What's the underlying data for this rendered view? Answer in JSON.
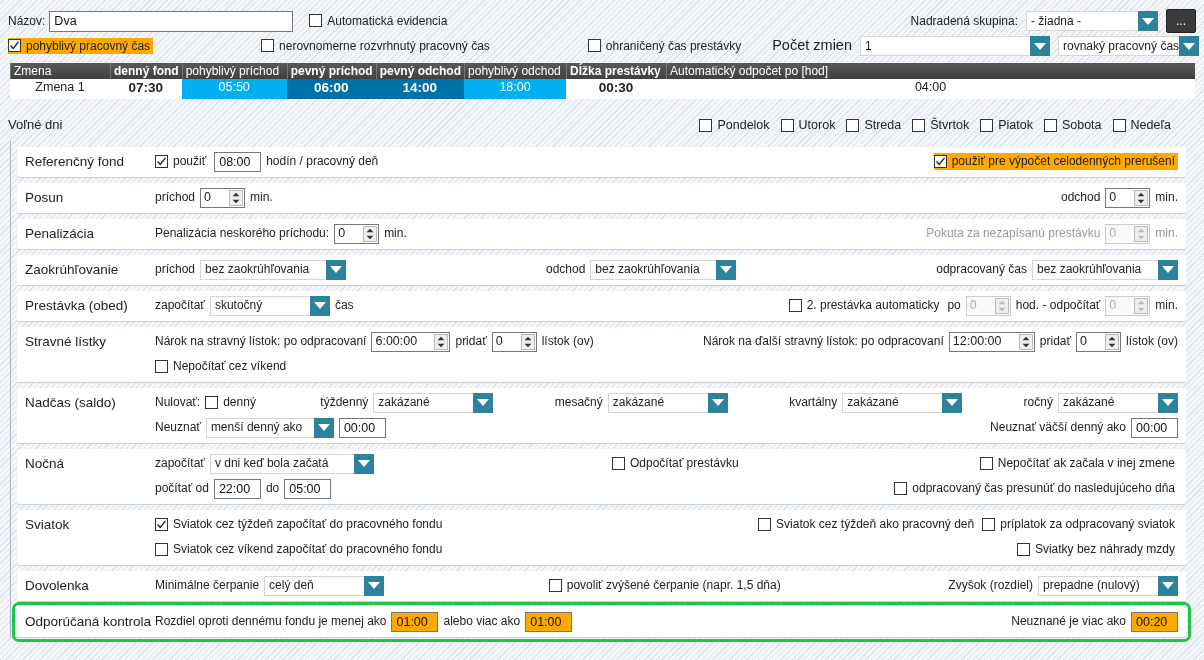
{
  "header": {
    "name_label": "Názov:",
    "name_value": "Dva",
    "auto_check": {
      "label": "Automatická evidencia",
      "checked": false
    },
    "parent_label": "Nadradená skupina:",
    "parent_value": "- žiadna -",
    "browse_button": "..."
  },
  "options": [
    {
      "label": "pohyblivý pracovný čas",
      "checked": true,
      "highlighted": true
    },
    {
      "label": "nerovnomerne rozvrhnutý pracovný čas",
      "checked": false,
      "highlighted": false
    },
    {
      "label": "ohraničený čas prestávky",
      "checked": false,
      "highlighted": false
    }
  ],
  "shift_count": {
    "label": "Počet zmien",
    "value": "1",
    "mode": "rovnaký pracovný čas"
  },
  "shift_table": {
    "columns": [
      {
        "label": "Zmena",
        "bold": false
      },
      {
        "label": "denný fond",
        "bold": true
      },
      {
        "label": "pohyblivý príchod",
        "bold": false
      },
      {
        "label": "pevný príchod",
        "bold": true
      },
      {
        "label": "pevný odchod",
        "bold": true
      },
      {
        "label": "pohyblivý odchod",
        "bold": false
      },
      {
        "label": "Dĺžka prestávky",
        "bold": true
      },
      {
        "label": "Automatický odpočet po [hod]",
        "bold": false
      }
    ],
    "rows": [
      {
        "cells": [
          {
            "text": "Zmena 1",
            "bold": false,
            "kind": "plain"
          },
          {
            "text": "07:30",
            "bold": true,
            "kind": "plain"
          },
          {
            "text": "05:50",
            "bold": false,
            "kind": "flexible"
          },
          {
            "text": "06:00",
            "bold": true,
            "kind": "fixed"
          },
          {
            "text": "14:00",
            "bold": true,
            "kind": "fixed"
          },
          {
            "text": "18:00",
            "bold": false,
            "kind": "flexible"
          },
          {
            "text": "00:30",
            "bold": true,
            "kind": "plain"
          },
          {
            "text": "04:00",
            "bold": false,
            "kind": "plain"
          }
        ]
      }
    ]
  },
  "free_days": {
    "label": "Voľné dni",
    "days": [
      {
        "label": "Pondelok",
        "checked": false
      },
      {
        "label": "Utorok",
        "checked": false
      },
      {
        "label": "Streda",
        "checked": false
      },
      {
        "label": "Štvrtok",
        "checked": false
      },
      {
        "label": "Piatok",
        "checked": false
      },
      {
        "label": "Sobota",
        "checked": false
      },
      {
        "label": "Nedeľa",
        "checked": false
      }
    ]
  },
  "sections": [
    {
      "label": "Referenčný fond",
      "emphasized": false,
      "lines": [
        [
          [
            {
              "kind": "check",
              "label": "použiť",
              "checked": true,
              "highlighted": false
            },
            {
              "kind": "field",
              "value": "08:00",
              "highlighted": false
            },
            {
              "kind": "text",
              "text": "hodín / pracovný deň",
              "disabled": false
            }
          ],
          [
            {
              "kind": "check",
              "label": "použiť pre výpočet celodenných prerušení",
              "checked": true,
              "highlighted": true
            }
          ]
        ]
      ]
    },
    {
      "label": "Posun",
      "emphasized": false,
      "lines": [
        [
          [
            {
              "kind": "text",
              "text": "príchod",
              "disabled": false
            },
            {
              "kind": "spin",
              "value": "0",
              "disabled": false
            },
            {
              "kind": "text",
              "text": "min.",
              "disabled": false
            }
          ],
          [
            {
              "kind": "text",
              "text": "odchod",
              "disabled": false
            },
            {
              "kind": "spin",
              "value": "0",
              "disabled": false
            },
            {
              "kind": "text",
              "text": "min.",
              "disabled": false
            }
          ]
        ]
      ]
    },
    {
      "label": "Penalizácia",
      "emphasized": false,
      "lines": [
        [
          [
            {
              "kind": "text",
              "text": "Penalizácia neskorého príchodu:",
              "disabled": false
            },
            {
              "kind": "spin",
              "value": "0",
              "disabled": false
            },
            {
              "kind": "text",
              "text": "min.",
              "disabled": false
            }
          ],
          [
            {
              "kind": "text",
              "text": "Pokuta za nezapísanú prestávku",
              "disabled": true
            },
            {
              "kind": "spin",
              "value": "0",
              "disabled": true
            },
            {
              "kind": "text",
              "text": "min.",
              "disabled": true
            }
          ]
        ]
      ]
    },
    {
      "label": "Zaokrúhľovanie",
      "emphasized": false,
      "lines": [
        [
          [
            {
              "kind": "text",
              "text": "príchod",
              "disabled": false
            },
            {
              "kind": "select",
              "value": "bez zaokrúhľovania"
            }
          ],
          [
            {
              "kind": "text",
              "text": "odchod",
              "disabled": false
            },
            {
              "kind": "select",
              "value": "bez zaokrúhľovania"
            }
          ],
          [
            {
              "kind": "text",
              "text": "odpracovaný čas",
              "disabled": false
            },
            {
              "kind": "select",
              "value": "bez zaokrúhľovania"
            }
          ]
        ]
      ]
    },
    {
      "label": "Prestávka (obed)",
      "emphasized": false,
      "lines": [
        [
          [
            {
              "kind": "text",
              "text": "započítať",
              "disabled": false
            },
            {
              "kind": "select",
              "value": "skutočný"
            },
            {
              "kind": "text",
              "text": "čas",
              "disabled": false
            }
          ],
          [
            {
              "kind": "check",
              "label": "2. prestávka automaticky",
              "checked": false,
              "highlighted": false
            },
            {
              "kind": "text",
              "text": "po",
              "disabled": false
            },
            {
              "kind": "spin",
              "value": "0",
              "disabled": true
            },
            {
              "kind": "text",
              "text": "hod. - odpočítať",
              "disabled": false
            },
            {
              "kind": "spin",
              "value": "0",
              "disabled": true
            },
            {
              "kind": "text",
              "text": "min.",
              "disabled": false
            }
          ]
        ]
      ]
    },
    {
      "label": "Stravné lístky",
      "emphasized": false,
      "lines": [
        [
          [
            {
              "kind": "text",
              "text": "Nárok na stravný lístok: po odpracovaní",
              "disabled": false
            },
            {
              "kind": "spin",
              "value": "6:00:00",
              "disabled": false
            },
            {
              "kind": "text",
              "text": "pridať",
              "disabled": false
            },
            {
              "kind": "spin",
              "value": "0",
              "disabled": false
            },
            {
              "kind": "text",
              "text": "lístok (ov)",
              "disabled": false
            }
          ],
          [
            {
              "kind": "text",
              "text": "Nárok na ďalší stravný lístok: po odpracovaní",
              "disabled": false
            },
            {
              "kind": "spin",
              "value": "12:00:00",
              "disabled": false
            },
            {
              "kind": "text",
              "text": "pridať",
              "disabled": false
            },
            {
              "kind": "spin",
              "value": "0",
              "disabled": false
            },
            {
              "kind": "text",
              "text": "lístok (ov)",
              "disabled": false
            }
          ]
        ],
        [
          [
            {
              "kind": "check",
              "label": "Nepočítať cez víkend",
              "checked": false,
              "highlighted": false
            }
          ]
        ]
      ]
    },
    {
      "label": "Nadčas (saldo)",
      "emphasized": false,
      "lines": [
        [
          [
            {
              "kind": "text",
              "text": "Nulovať:",
              "disabled": false
            },
            {
              "kind": "check",
              "label": "denný",
              "checked": false,
              "highlighted": false
            }
          ],
          [
            {
              "kind": "text",
              "text": "týždenný",
              "disabled": false
            },
            {
              "kind": "select",
              "value": "zakázané"
            }
          ],
          [
            {
              "kind": "text",
              "text": "mesačný",
              "disabled": false
            },
            {
              "kind": "select",
              "value": "zakázané"
            }
          ],
          [
            {
              "kind": "text",
              "text": "kvartálny",
              "disabled": false
            },
            {
              "kind": "select",
              "value": "zakázané"
            }
          ],
          [
            {
              "kind": "text",
              "text": "ročný",
              "disabled": false
            },
            {
              "kind": "select",
              "value": "zakázané"
            }
          ]
        ],
        [
          [
            {
              "kind": "text",
              "text": "Neuznať",
              "disabled": false
            },
            {
              "kind": "select",
              "value": "menší denný ako"
            },
            {
              "kind": "field",
              "value": "00:00",
              "highlighted": false
            }
          ],
          [
            {
              "kind": "text",
              "text": "Neuznať väčší denný ako",
              "disabled": false
            },
            {
              "kind": "field",
              "value": "00:00",
              "highlighted": false
            }
          ]
        ]
      ]
    },
    {
      "label": "Nočná",
      "emphasized": false,
      "lines": [
        [
          [
            {
              "kind": "text",
              "text": "započítať",
              "disabled": false
            },
            {
              "kind": "select",
              "value": "v dni keď bola začatá"
            }
          ],
          [
            {
              "kind": "check",
              "label": "Odpočítať prestávku",
              "checked": false,
              "highlighted": false
            }
          ],
          [
            {
              "kind": "check",
              "label": "Nepočítať ak začala v inej zmene",
              "checked": false,
              "highlighted": false
            }
          ]
        ],
        [
          [
            {
              "kind": "text",
              "text": "počítať od",
              "disabled": false
            },
            {
              "kind": "field",
              "value": "22:00",
              "highlighted": false
            },
            {
              "kind": "text",
              "text": "do",
              "disabled": false
            },
            {
              "kind": "field",
              "value": "05:00",
              "highlighted": false
            }
          ],
          [
            {
              "kind": "check",
              "label": "odpracovaný čas presunúť do nasledujúceho dňa",
              "checked": false,
              "highlighted": false
            }
          ]
        ]
      ]
    },
    {
      "label": "Sviatok",
      "emphasized": false,
      "lines": [
        [
          [
            {
              "kind": "check",
              "label": "Sviatok cez týždeň započítať do pracovného fondu",
              "checked": true,
              "highlighted": false
            }
          ],
          [
            {
              "kind": "check",
              "label": "Sviatok cez týždeň ako pracovný deň",
              "checked": false,
              "highlighted": false
            },
            {
              "kind": "check",
              "label": "príplatok za odpracovaný sviatok",
              "checked": false,
              "highlighted": false
            }
          ]
        ],
        [
          [
            {
              "kind": "check",
              "label": "Sviatok cez víkend započítať do pracovného fondu",
              "checked": false,
              "highlighted": false
            }
          ],
          [
            {
              "kind": "check",
              "label": "Sviatky bez náhrady mzdy",
              "checked": false,
              "highlighted": false
            }
          ]
        ]
      ]
    },
    {
      "label": "Dovolenka",
      "emphasized": false,
      "lines": [
        [
          [
            {
              "kind": "text",
              "text": "Minimálne čerpanie",
              "disabled": false
            },
            {
              "kind": "select",
              "value": "celý deň"
            }
          ],
          [
            {
              "kind": "check",
              "label": "povoliť zvýšené čerpanie (napr. 1,5 dňa)",
              "checked": false,
              "highlighted": false
            }
          ],
          [
            {
              "kind": "text",
              "text": "Zvyšok (rozdiel)",
              "disabled": false
            },
            {
              "kind": "select",
              "value": "prepadne (nulový)"
            }
          ]
        ]
      ]
    },
    {
      "label": "Odporúčaná kontrola",
      "emphasized": true,
      "lines": [
        [
          [
            {
              "kind": "text",
              "text": "Rozdiel oproti dennému fondu je menej ako",
              "disabled": false
            },
            {
              "kind": "field",
              "value": "01:00",
              "highlighted": true
            },
            {
              "kind": "text",
              "text": "alebo viac ako",
              "disabled": false
            },
            {
              "kind": "field",
              "value": "01:00",
              "highlighted": true
            }
          ],
          [
            {
              "kind": "text",
              "text": "Neuznané je viac ako",
              "disabled": false
            },
            {
              "kind": "field",
              "value": "00:20",
              "highlighted": true
            }
          ]
        ]
      ]
    }
  ]
}
